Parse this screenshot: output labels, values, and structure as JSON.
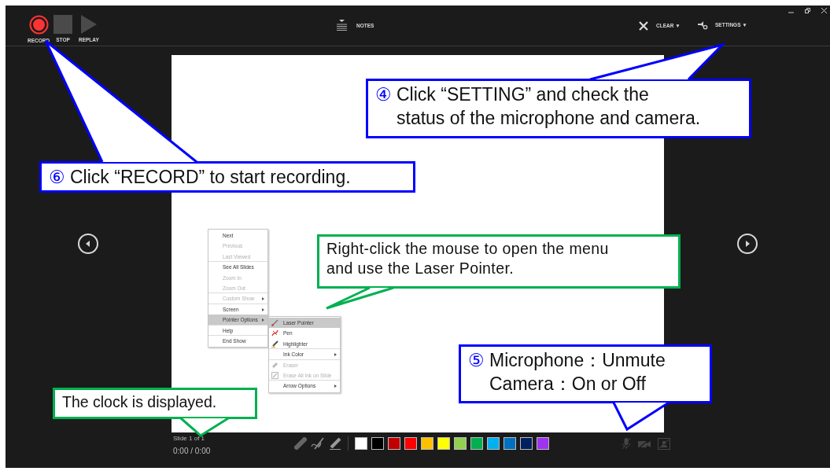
{
  "toolbar": {
    "record_controls": [
      {
        "label": "RECORD",
        "kind": "record"
      },
      {
        "label": "STOP",
        "kind": "stop"
      },
      {
        "label": "REPLAY",
        "kind": "replay"
      }
    ],
    "notes": {
      "label": "NOTES"
    },
    "clear": {
      "label": "CLEAR",
      "caret": "▼"
    },
    "settings": {
      "label": "SETTINGS",
      "caret": "▼"
    }
  },
  "context_menu": {
    "items": [
      {
        "label": "Next",
        "disabled": false,
        "submenu": false,
        "selected": false,
        "separator_after": false
      },
      {
        "label": "Previous",
        "disabled": true,
        "submenu": false,
        "selected": false,
        "separator_after": false
      },
      {
        "label": "Last Viewed",
        "disabled": true,
        "submenu": false,
        "selected": false,
        "separator_after": true
      },
      {
        "label": "See All Slides",
        "disabled": false,
        "submenu": false,
        "selected": false,
        "separator_after": false
      },
      {
        "label": "Zoom In",
        "disabled": true,
        "submenu": false,
        "selected": false,
        "separator_after": false
      },
      {
        "label": "Zoom Out",
        "disabled": true,
        "submenu": false,
        "selected": false,
        "separator_after": true
      },
      {
        "label": "Custom Show",
        "disabled": true,
        "submenu": true,
        "selected": false,
        "separator_after": true
      },
      {
        "label": "Screen",
        "disabled": false,
        "submenu": true,
        "selected": false,
        "separator_after": false
      },
      {
        "label": "Pointer Options",
        "disabled": false,
        "submenu": true,
        "selected": true,
        "separator_after": true
      },
      {
        "label": "Help",
        "disabled": false,
        "submenu": false,
        "selected": false,
        "separator_after": true
      },
      {
        "label": "End Show",
        "disabled": false,
        "submenu": false,
        "selected": false,
        "separator_after": false
      }
    ]
  },
  "pointer_submenu": {
    "items": [
      {
        "label": "Laser Pointer",
        "kind": "laser",
        "disabled": false,
        "submenu": false,
        "selected": true,
        "separator_after": false
      },
      {
        "label": "Pen",
        "kind": "pen",
        "disabled": false,
        "submenu": false,
        "selected": false,
        "separator_after": false
      },
      {
        "label": "Highlighter",
        "kind": "highlighter",
        "disabled": false,
        "submenu": false,
        "selected": false,
        "separator_after": true
      },
      {
        "label": "Ink Color",
        "kind": "plain",
        "disabled": false,
        "submenu": true,
        "selected": false,
        "separator_after": true
      },
      {
        "label": "Eraser",
        "kind": "eraser",
        "disabled": true,
        "submenu": false,
        "selected": false,
        "separator_after": false
      },
      {
        "label": "Erase All Ink on Slide",
        "kind": "erase-all",
        "disabled": true,
        "submenu": false,
        "selected": false,
        "separator_after": true
      },
      {
        "label": "Arrow Options",
        "kind": "plain",
        "disabled": false,
        "submenu": true,
        "selected": false,
        "separator_after": false
      }
    ]
  },
  "bottom_bar": {
    "slide_counter": "Slide 1 of 1",
    "timer": "0:00 / 0:00",
    "ink_colors": [
      {
        "color": "#ffffff"
      },
      {
        "color": "#000000"
      },
      {
        "color": "#c00000"
      },
      {
        "color": "#ff0000"
      },
      {
        "color": "#ffc000"
      },
      {
        "color": "#ffff00"
      },
      {
        "color": "#92d050"
      },
      {
        "color": "#00b050"
      },
      {
        "color": "#00b0f0"
      },
      {
        "color": "#0070c0"
      },
      {
        "color": "#002060"
      },
      {
        "color": "#a033f0"
      }
    ]
  },
  "callouts": [
    {
      "color": "#0000ff",
      "number": "④",
      "lines": [
        "Click “SETTING” and check the",
        "status of the microphone and camera."
      ]
    },
    {
      "color": "#0000ff",
      "number": "⑥",
      "lines": [
        "Click “RECORD” to start recording."
      ]
    },
    {
      "color": "#00b050",
      "lines": [
        "Right-click the mouse to open the menu",
        "and use the Laser Pointer."
      ]
    },
    {
      "color": "#0000ff",
      "number": "⑤",
      "lines": [
        "Microphone：Unmute",
        "Camera：On or Off"
      ]
    },
    {
      "color": "#00b050",
      "lines": [
        "The clock is displayed."
      ]
    }
  ]
}
